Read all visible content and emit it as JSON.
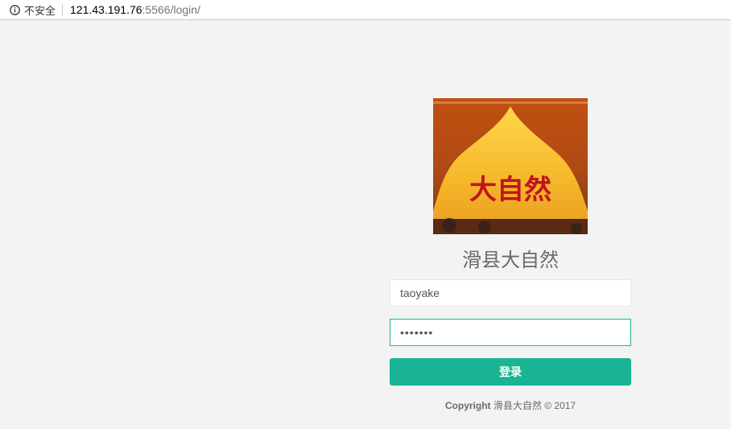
{
  "browser": {
    "security_label": "不安全",
    "url_host": "121.43.191.76",
    "url_rest": ":5566/login/"
  },
  "logo": {
    "text": "大自然"
  },
  "login": {
    "title": "滑县大自然",
    "username_value": "taoyake",
    "password_value": "1234567",
    "submit_label": "登录"
  },
  "footer": {
    "copyright_bold": "Copyright",
    "copyright_rest": " 滑县大自然 © 2017"
  },
  "colors": {
    "accent": "#1ab394",
    "background": "#f3f3f4",
    "text": "#676a6c"
  }
}
